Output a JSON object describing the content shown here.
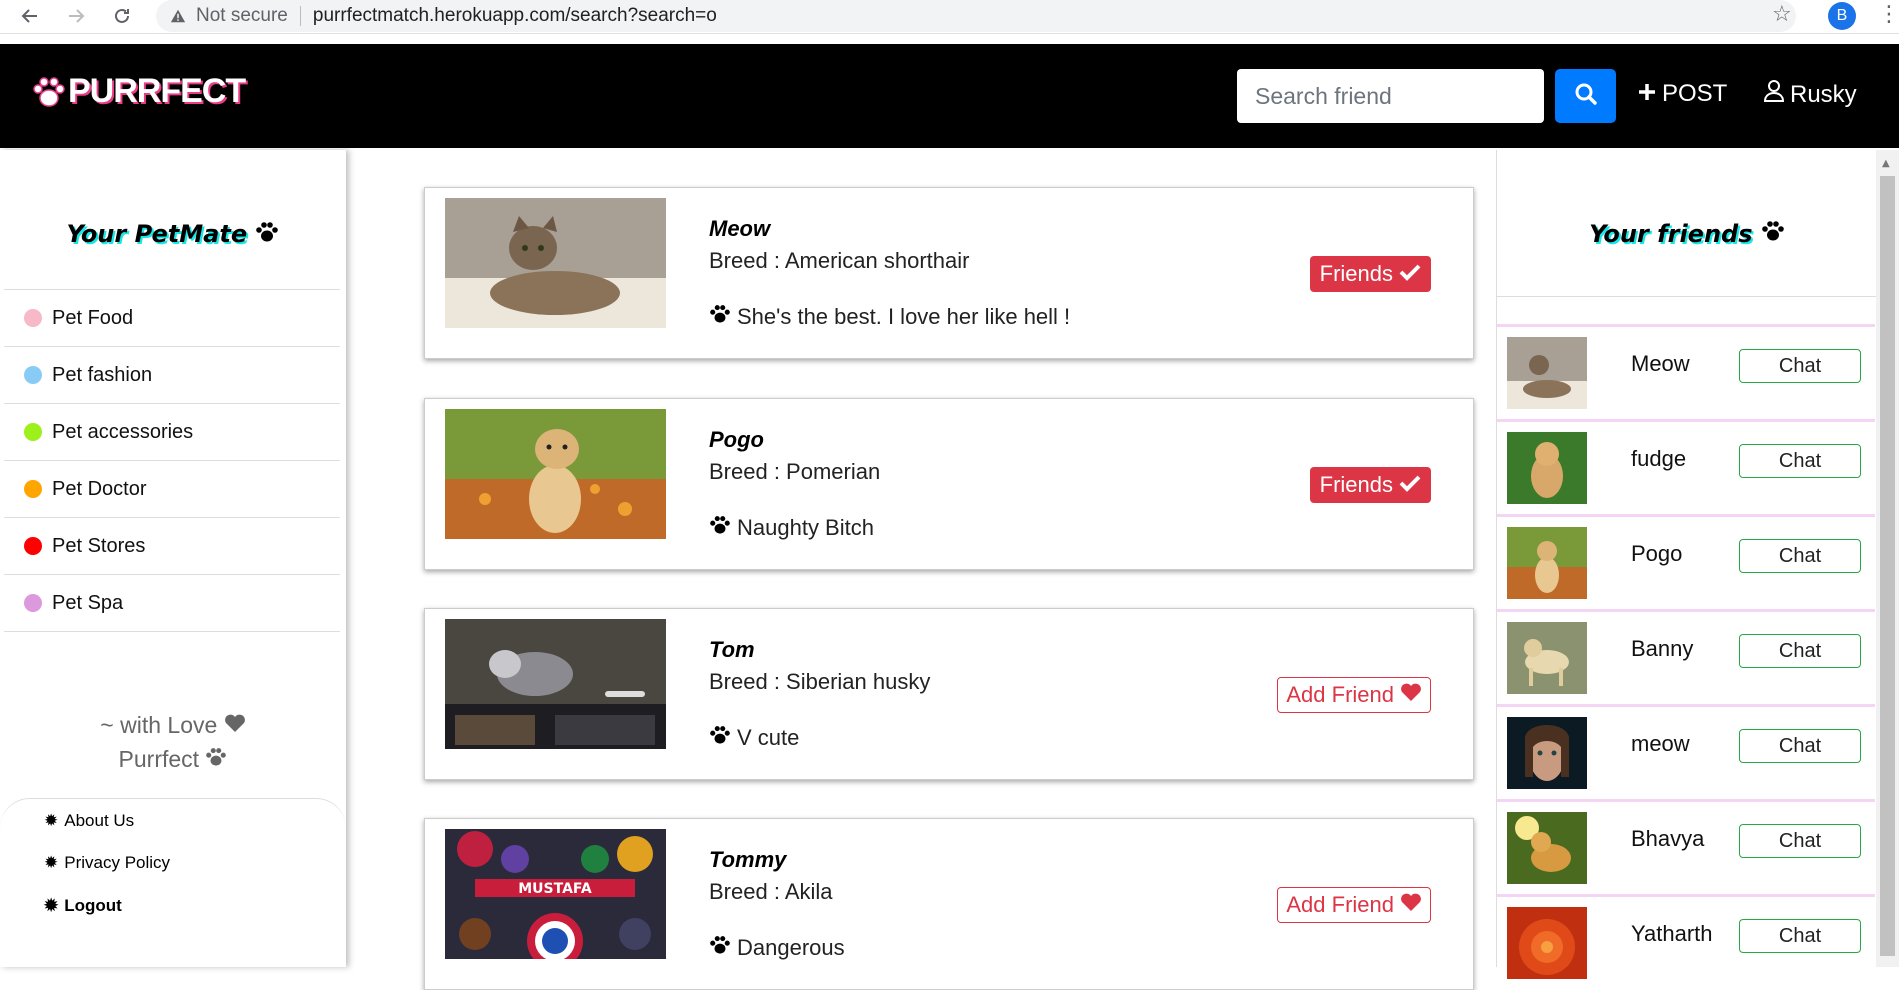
{
  "browser": {
    "security_label": "Not secure",
    "url": "purrfectmatch.herokuapp.com/search?search=o",
    "profile_initial": "B"
  },
  "header": {
    "logo_text": "PURRFECT",
    "search_placeholder": "Search friend",
    "post_label": "POST",
    "user_label": "Rusky"
  },
  "left_sidebar": {
    "title": "Your PetMate",
    "categories": [
      {
        "label": "Pet Food",
        "color": "#f7b8c8"
      },
      {
        "label": "Pet fashion",
        "color": "#88ccf5"
      },
      {
        "label": "Pet accessories",
        "color": "#9ef01a"
      },
      {
        "label": "Pet Doctor",
        "color": "#ffa500"
      },
      {
        "label": "Pet Stores",
        "color": "#ff0000"
      },
      {
        "label": "Pet Spa",
        "color": "#dd99dd"
      }
    ],
    "love_line1": "~ with Love",
    "love_line2": "Purrfect",
    "footer": {
      "about": "About Us",
      "privacy": "Privacy Policy",
      "logout": "Logout"
    }
  },
  "feed": [
    {
      "name": "Meow",
      "breed": "Breed : American shorthair",
      "desc": "She's the best. I love her like hell !",
      "status": "Friends"
    },
    {
      "name": "Pogo",
      "breed": "Breed : Pomerian",
      "desc": "Naughty Bitch",
      "status": "Friends"
    },
    {
      "name": "Tom",
      "breed": "Breed : Siberian husky",
      "desc": "V cute",
      "status": "Add Friend"
    },
    {
      "name": "Tommy",
      "breed": "Breed : Akila",
      "desc": "Dangerous",
      "status": "Add Friend"
    }
  ],
  "right_sidebar": {
    "title": "Your friends",
    "chat_label": "Chat",
    "friends": [
      {
        "name": "Meow"
      },
      {
        "name": "fudge"
      },
      {
        "name": "Pogo"
      },
      {
        "name": "Banny"
      },
      {
        "name": "meow"
      },
      {
        "name": "Bhavya"
      },
      {
        "name": "Yatharth"
      }
    ]
  },
  "colors": {
    "header_bg": "#000000",
    "search_btn": "#007bff",
    "friends_badge": "#dc3545",
    "chat_border": "#28a745",
    "title_shadow": "#19e6e6"
  }
}
